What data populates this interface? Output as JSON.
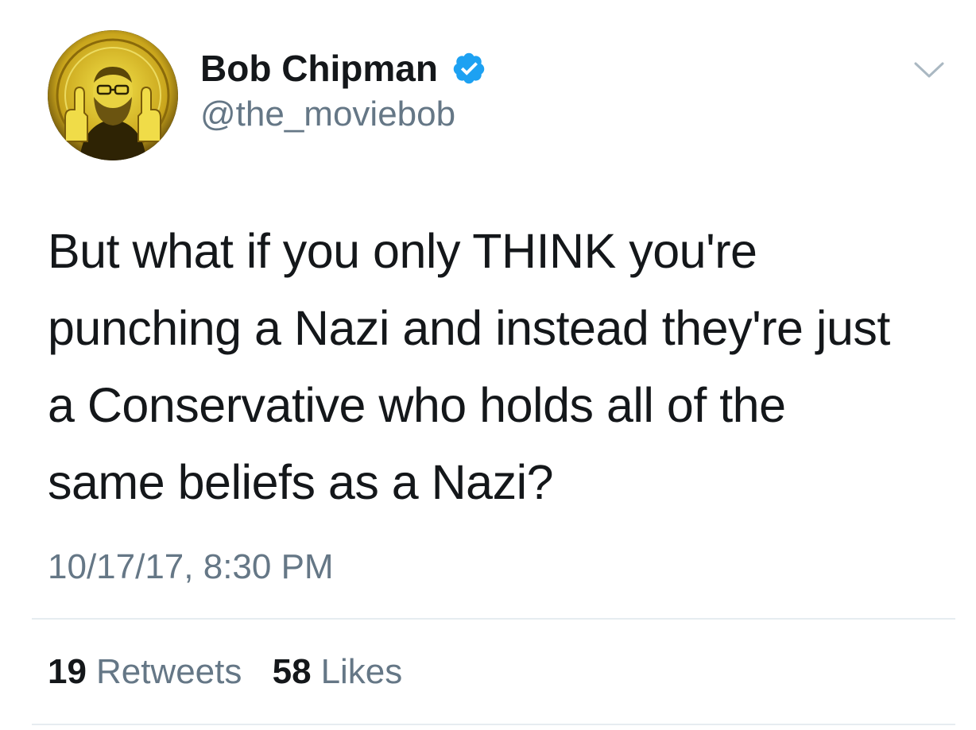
{
  "user": {
    "display_name": "Bob Chipman",
    "handle": "@the_moviebob",
    "verified": true
  },
  "tweet": {
    "text_lines": [
      "But what if you only THINK you're",
      "punching a Nazi and instead they're just",
      "a Conservative who holds all of the",
      "same beliefs as a Nazi?"
    ],
    "timestamp": "10/17/17, 8:30 PM"
  },
  "stats": {
    "retweets_count": "19",
    "retweets_label": "Retweets",
    "likes_count": "58",
    "likes_label": "Likes"
  },
  "colors": {
    "verified_blue": "#1da1f2",
    "secondary_text": "#657786",
    "primary_text": "#14171a",
    "divider": "#e6ecf0"
  },
  "icons": {
    "verified": "verified-badge-icon",
    "menu": "chevron-down-icon"
  }
}
